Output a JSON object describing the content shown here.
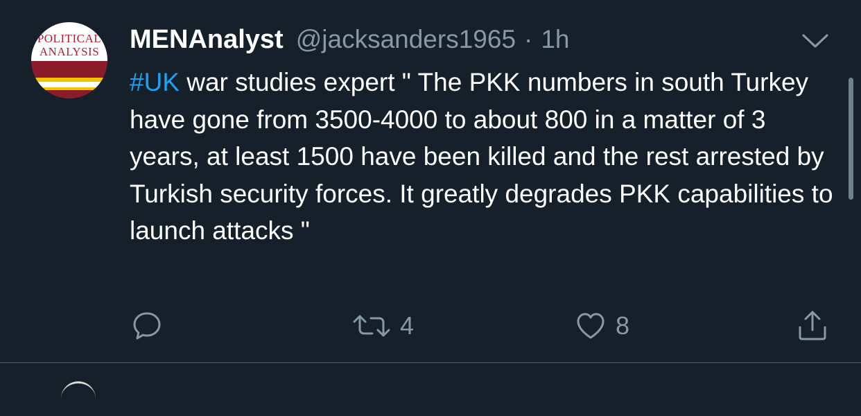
{
  "tweet": {
    "avatar": {
      "logo_line1": "POLITICAL",
      "logo_line2": "ANALYSIS"
    },
    "author": {
      "display_name": "MENAnalyst",
      "handle": "@jacksanders1965",
      "separator": "·",
      "time": "1h"
    },
    "body": {
      "hashtag": "#UK",
      "text": " war studies expert \" The PKK numbers in south Turkey have gone from 3500-4000 to about 800 in a matter of 3 years, at least 1500 have been killed and the rest arrested by Turkish security forces. It greatly degrades PKK capabilities to launch attacks \""
    },
    "actions": {
      "reply_icon": "reply-icon",
      "retweet_icon": "retweet-icon",
      "retweet_count": "4",
      "like_icon": "heart-icon",
      "like_count": "8",
      "share_icon": "share-icon"
    }
  },
  "colors": {
    "background": "#15202b",
    "text": "#ffffff",
    "secondary": "#8899a6",
    "link": "#1da1f2",
    "divider": "#38444d"
  }
}
